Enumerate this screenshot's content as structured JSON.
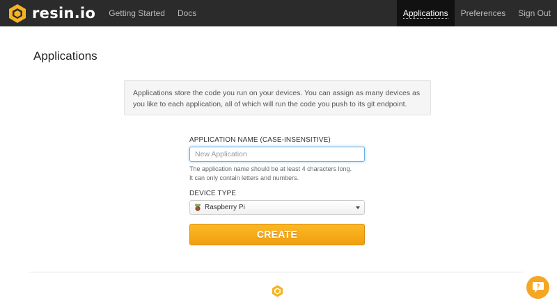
{
  "brand": {
    "name": "resin.io",
    "accent": "#f5a623"
  },
  "nav": {
    "left": [
      "Getting Started",
      "Docs"
    ],
    "right": [
      "Applications",
      "Preferences",
      "Sign Out"
    ],
    "active": "Applications"
  },
  "page": {
    "title": "Applications",
    "info": "Applications store the code you run on your devices. You can assign as many devices as you like to each application, all of which will run the code you push to its git endpoint."
  },
  "form": {
    "name_label": "APPLICATION NAME (CASE-INSENSITIVE)",
    "name_placeholder": "New Application",
    "name_value": "",
    "help_line1": "The application name should be at least 4 characters long.",
    "help_line2": "It can only contain letters and numbers.",
    "type_label": "DEVICE TYPE",
    "type_value": "Raspberry Pi",
    "type_icon": "raspberry-pi-icon",
    "create_label": "CREATE"
  },
  "support": {
    "icon": "chat-question-icon"
  }
}
